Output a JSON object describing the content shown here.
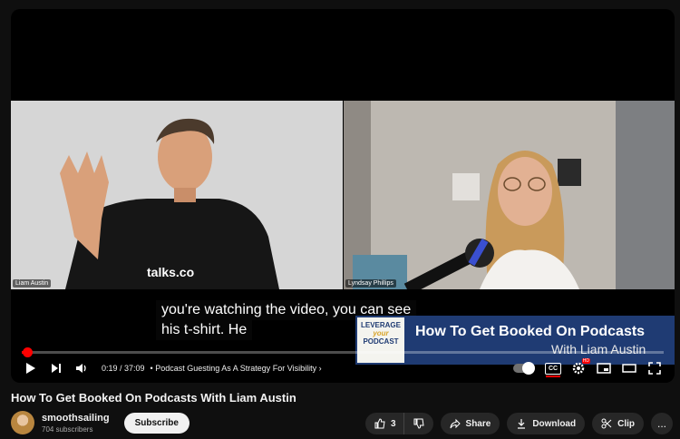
{
  "video": {
    "left_name": "Liam Austin",
    "right_name": "Lyndsay Phillips",
    "shirt_text": "talks.co",
    "subtitle_lines": [
      "you're watching the video, you can see",
      "his t-shirt. He"
    ],
    "promo_logo": [
      "LEVERAGE",
      "your",
      "PODCAST"
    ],
    "promo_title": "How To Get Booked On Podcasts",
    "promo_subtitle": "With Liam Austin"
  },
  "player": {
    "progress_fraction": 0.0084,
    "time": "0:19 / 37:09",
    "chapter": "Podcast Guesting As A Strategy For Visibility",
    "chapter_chevron": "›",
    "cc_label": "CC",
    "hd_badge": "HD",
    "colors": {
      "progress": "#ff0000",
      "promo_bg": "#1f3b73"
    }
  },
  "meta": {
    "title": "How To Get Booked On Podcasts With Liam Austin",
    "channel": "smoothsailing",
    "subscribers": "704 subscribers",
    "subscribe": "Subscribe",
    "likes": "3",
    "share": "Share",
    "download": "Download",
    "clip": "Clip",
    "more": "..."
  },
  "icons": [
    "play-icon",
    "next-icon",
    "volume-icon",
    "autoplay-toggle",
    "cc-icon",
    "settings-icon",
    "miniplayer-icon",
    "theater-icon",
    "fullscreen-icon",
    "like-icon",
    "dislike-icon",
    "share-icon",
    "download-icon",
    "clip-icon",
    "more-icon"
  ]
}
